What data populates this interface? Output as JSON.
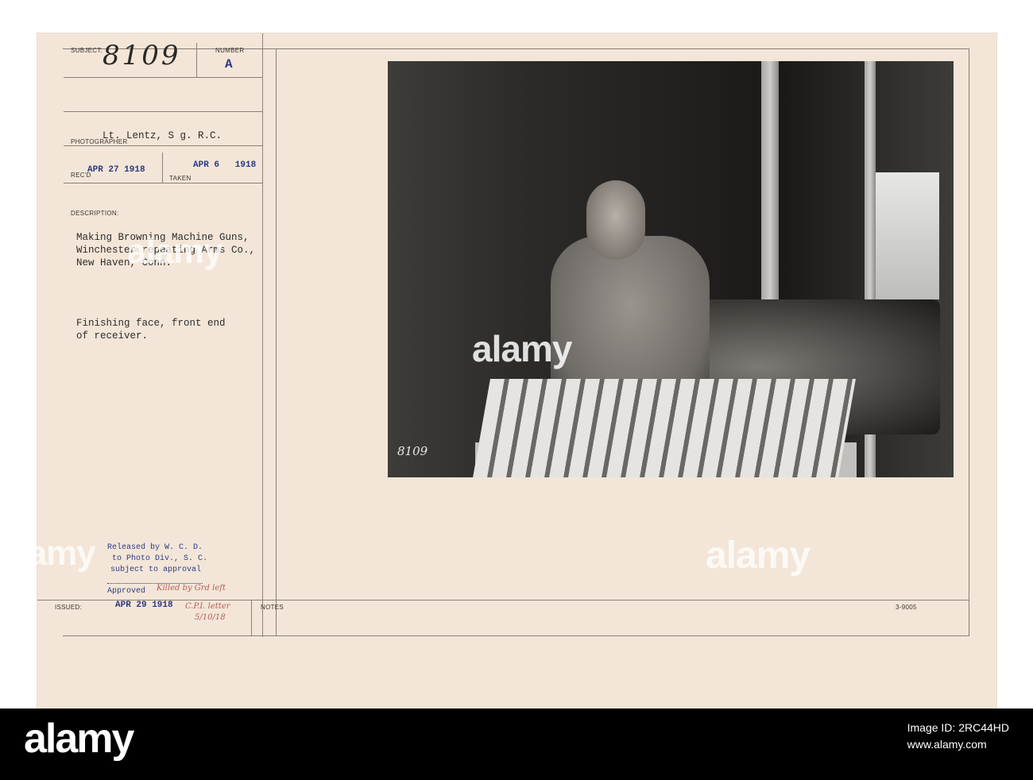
{
  "card": {
    "subject_label": "SUBJECT:",
    "subject_value": "8109",
    "number_label": "NUMBER",
    "number_value": "A",
    "photographer_label": "PHOTOGRAPHER",
    "photographer_value": "Lt. Lentz, S g. R.C.",
    "recd_label": "REC'D",
    "recd_value": "APR 27 1918",
    "taken_label": "TAKEN",
    "taken_value": "APR 6   1918",
    "description_label": "DESCRIPTION:",
    "description_lines": [
      "Making Browning Machine Guns,",
      "Winchester repeating Arms Co.,",
      "New Haven, Conn."
    ],
    "caption_lines": [
      "Finishing face, front end",
      "of receiver."
    ],
    "release_lines": [
      "Released by W. C. D.",
      "to Photo Div., S. C.",
      "subject to approval"
    ],
    "approved_label": "Approved",
    "approved_note": "Killed by Grd left",
    "issued_label": "ISSUED:",
    "issued_value": "APR 29 1918",
    "issued_note_1": "C.P.I. letter",
    "issued_note_2": "5/10/18",
    "notes_label": "NOTES",
    "form_number": "3-9005",
    "photo_negative_number": "8109"
  },
  "watermarks": [
    "alamy",
    "alamy",
    "alamy",
    "alamy"
  ],
  "footer": {
    "logo": "alamy",
    "image_id_label": "Image ID: 2RC44HD",
    "site": "www.alamy.com"
  }
}
